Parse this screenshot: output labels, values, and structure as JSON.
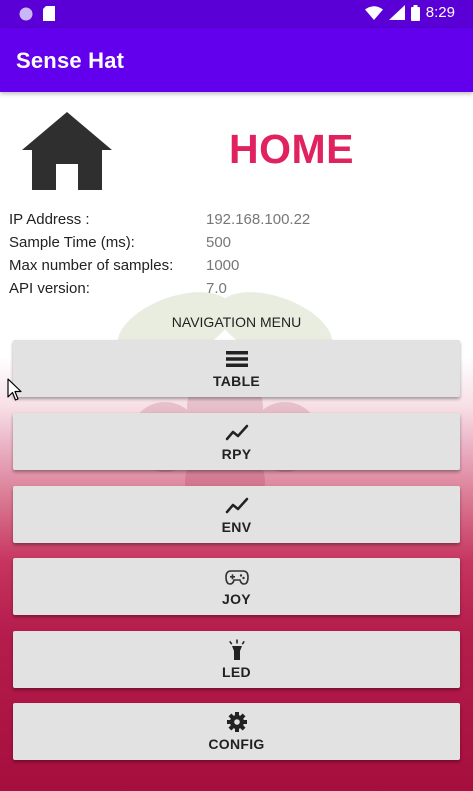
{
  "status_bar": {
    "time": "8:29",
    "icons": [
      "circle-icon",
      "sd-card-icon",
      "wifi-icon",
      "signal-icon",
      "battery-icon"
    ]
  },
  "app": {
    "title": "Sense Hat",
    "primary_color": "#6200ee",
    "accent_color": "#e0225f"
  },
  "home": {
    "title": "HOME",
    "icon": "house-icon"
  },
  "info": [
    {
      "label": "IP Address :",
      "value": "192.168.100.22"
    },
    {
      "label": "Sample Time (ms):",
      "value": "500"
    },
    {
      "label": "Max number of samples:",
      "value": "1000"
    },
    {
      "label": "API version:",
      "value": "7.0"
    }
  ],
  "navigation": {
    "heading": "NAVIGATION MENU",
    "buttons": [
      {
        "label": "TABLE",
        "icon": "list-icon"
      },
      {
        "label": "RPY",
        "icon": "chart-line-icon"
      },
      {
        "label": "ENV",
        "icon": "chart-line-icon"
      },
      {
        "label": "JOY",
        "icon": "gamepad-icon"
      },
      {
        "label": "LED",
        "icon": "flashlight-icon"
      },
      {
        "label": "CONFIG",
        "icon": "gear-icon"
      }
    ]
  }
}
